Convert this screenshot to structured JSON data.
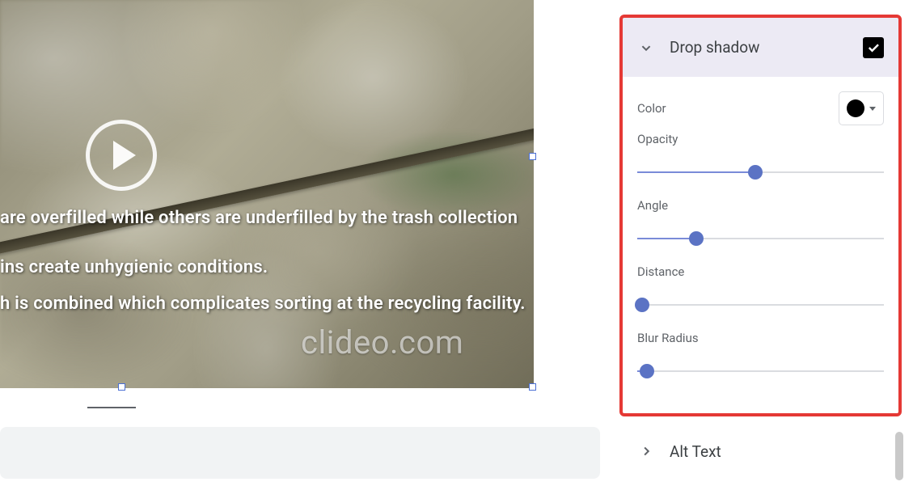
{
  "video": {
    "caption_line1": "are overfilled while others are underfilled by the trash collection",
    "caption_line2": "ins create unhygienic conditions.",
    "caption_line3": "h is combined which complicates sorting at the recycling facility.",
    "watermark": "clideo.com"
  },
  "sidebar": {
    "drop_shadow": {
      "title": "Drop shadow",
      "enabled": true,
      "color_label": "Color",
      "color_value": "#000000",
      "opacity_label": "Opacity",
      "opacity_pct": 48,
      "angle_label": "Angle",
      "angle_pct": 24,
      "distance_label": "Distance",
      "distance_pct": 2,
      "blur_label": "Blur Radius",
      "blur_pct": 4
    },
    "alt_text": {
      "title": "Alt Text"
    }
  }
}
